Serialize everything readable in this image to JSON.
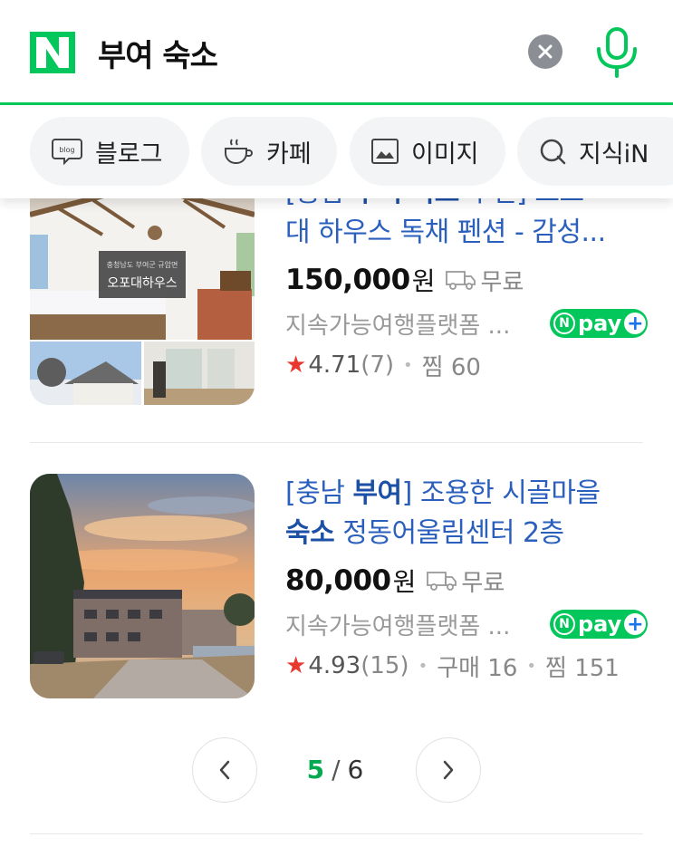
{
  "search": {
    "query": "부여 숙소"
  },
  "colors": {
    "brand": "#03c75a",
    "link": "#2a5fbd",
    "star": "#e8372f",
    "chip_bg": "#f2f4f6"
  },
  "tabs": [
    {
      "label": "블로그",
      "icon": "blog-icon"
    },
    {
      "label": "카페",
      "icon": "cafe-cup-icon"
    },
    {
      "label": "이미지",
      "icon": "image-icon"
    },
    {
      "label": "지식iN",
      "icon": "kin-icon"
    }
  ],
  "products": [
    {
      "title_parts": [
        "[충남 ",
        "부여",
        " ",
        "숙소",
        " 추전] 오포",
        "대 하우스 독채 펜션 - 감성..."
      ],
      "price": "150,000",
      "price_unit": "원",
      "shipping": "무료",
      "seller": "지속가능여행플랫폼 ...",
      "npay": "pay",
      "rating": "4.71",
      "reviews": "(7)",
      "extra": [
        "찜 60"
      ],
      "thumb_caption_top": "충청남도 부여군 규암면",
      "thumb_caption_main": "오포대하우스"
    },
    {
      "title_parts": [
        "[충남 ",
        "부여",
        "] 조용한 시골마을",
        "숙소",
        " 정동어울림센터 2층"
      ],
      "price": "80,000",
      "price_unit": "원",
      "shipping": "무료",
      "seller": "지속가능여행플랫폼 ...",
      "npay": "pay",
      "rating": "4.93",
      "reviews": "(15)",
      "extra": [
        "구매 16",
        "찜 151"
      ]
    }
  ],
  "pagination": {
    "current": "5",
    "separator": "/",
    "total": "6"
  }
}
